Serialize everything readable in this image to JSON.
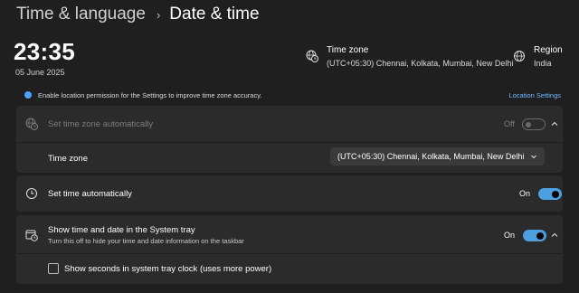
{
  "breadcrumb": {
    "parent": "Time & language",
    "separator": "›",
    "current": "Date & time"
  },
  "clock": {
    "time": "23:35",
    "date": "05 June 2025"
  },
  "timezone_info": {
    "title": "Time zone",
    "value": "(UTC+05:30) Chennai, Kolkata, Mumbai, New Delhi",
    "icon": "globe-clock-icon"
  },
  "region_info": {
    "title": "Region",
    "value": "India",
    "icon": "globe-icon"
  },
  "notice": {
    "text": "Enable location permission for the Settings to improve time zone accuracy.",
    "link": "Location Settings",
    "accent": "#4da3ff"
  },
  "auto_timezone": {
    "label": "Set time zone automatically",
    "state": "Off",
    "enabled": false
  },
  "timezone_select": {
    "label": "Time zone",
    "value": "(UTC+05:30) Chennai, Kolkata, Mumbai, New Delhi"
  },
  "auto_time": {
    "label": "Set time automatically",
    "state": "On",
    "on": true
  },
  "systray": {
    "label": "Show time and date in the System tray",
    "sublabel": "Turn this off to hide your time and date information on the taskbar",
    "state": "On",
    "on": true
  },
  "seconds_option": {
    "label": "Show seconds in system tray clock (uses more power)",
    "checked": false
  },
  "colors": {
    "background": "#1f1f1f",
    "card": "#2b2b2b",
    "toggle_on": "#4ca0e0",
    "link": "#6cb8ff"
  }
}
